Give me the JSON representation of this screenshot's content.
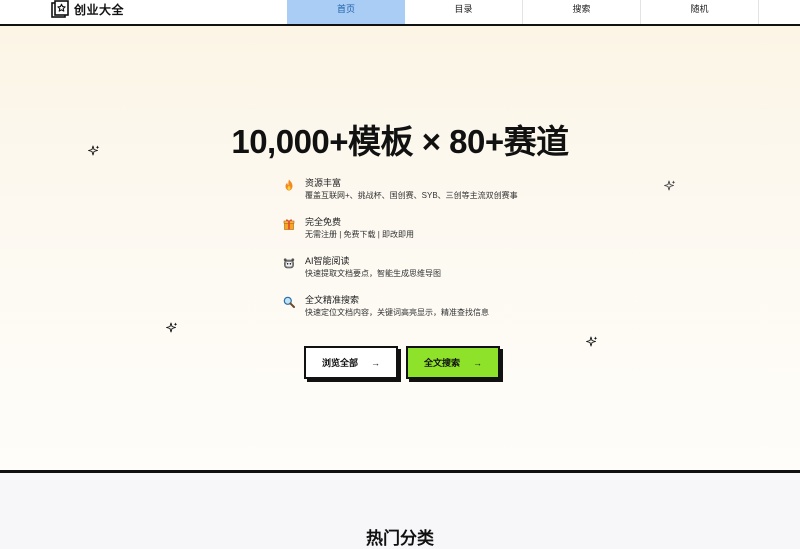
{
  "header": {
    "brand": "创业大全",
    "nav": [
      {
        "label": "首页",
        "active": true
      },
      {
        "label": "目录",
        "active": false
      },
      {
        "label": "搜索",
        "active": false
      },
      {
        "label": "随机",
        "active": false
      }
    ]
  },
  "hero": {
    "title": "10,000+模板 × 80+赛道",
    "features": [
      {
        "icon": "fire-icon",
        "title": "资源丰富",
        "desc": "覆盖互联网+、挑战杯、国创赛、SYB、三创等主流双创赛事"
      },
      {
        "icon": "gift-icon",
        "title": "完全免费",
        "desc": "无需注册 | 免费下载 | 即改即用"
      },
      {
        "icon": "robot-icon",
        "title": "AI智能阅读",
        "desc": "快速提取文档要点，智能生成思维导图"
      },
      {
        "icon": "magnifier-icon",
        "title": "全文精准搜索",
        "desc": "快速定位文档内容，关键词高亮显示，精准查找信息"
      }
    ],
    "buttons": {
      "browse_label": "浏览全部",
      "search_label": "全文搜索",
      "arrow": "→"
    }
  },
  "categories": {
    "title": "热门分类"
  },
  "colors": {
    "nav_active_bg": "#a9cdf5",
    "nav_active_text": "#1f5fa8",
    "search_button_bg": "#8ee32a",
    "border": "#111111"
  }
}
